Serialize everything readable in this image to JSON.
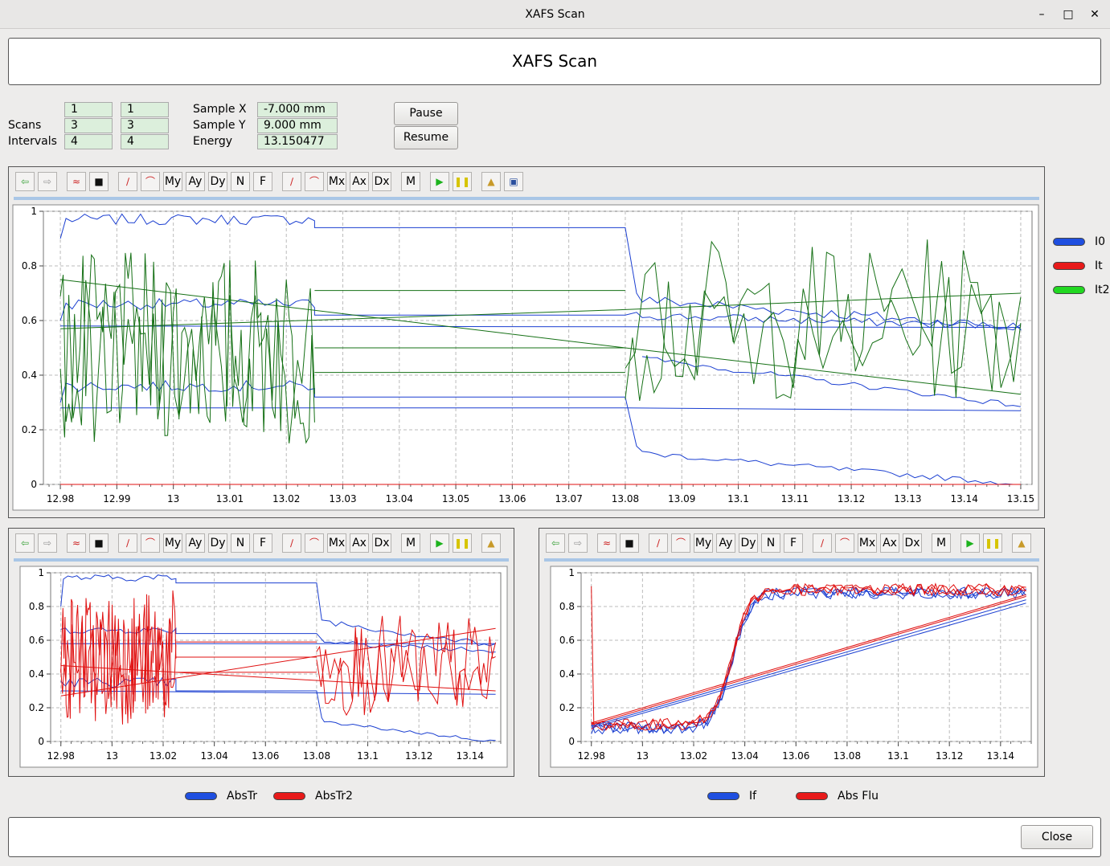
{
  "window": {
    "title": "XAFS Scan",
    "minimize_icon": "minimize-icon",
    "maximize_icon": "maximize-icon",
    "close_icon": "close-icon"
  },
  "header": {
    "title": "XAFS Scan"
  },
  "status": {
    "scans_label": "Scans",
    "intervals_label": "Intervals",
    "col1": [
      "1",
      "3",
      "4"
    ],
    "col2": [
      "1",
      "3",
      "4"
    ],
    "sample_x_label": "Sample X",
    "sample_y_label": "Sample Y",
    "energy_label": "Energy",
    "sample_x": "-7.000 mm",
    "sample_y": "9.000 mm",
    "energy": "13.150477"
  },
  "buttons": {
    "pause": "Pause",
    "resume": "Resume",
    "close": "Close"
  },
  "toolbar": {
    "labels": [
      "My",
      "Ay",
      "Dy",
      "N",
      "F",
      "Mx",
      "Ax",
      "Dx",
      "M"
    ]
  },
  "colors": {
    "blue": "#1b3fd1",
    "red": "#e01010",
    "green": "#157015",
    "legend_blue": "#1f4fe0",
    "legend_red": "#e81a1a",
    "legend_green": "#22d822"
  },
  "chart_data": [
    {
      "type": "line",
      "x_ticks": [
        "12.98",
        "12.99",
        "13",
        "13.01",
        "13.02",
        "13.03",
        "13.04",
        "13.05",
        "13.06",
        "13.07",
        "13.08",
        "13.09",
        "13.1",
        "13.11",
        "13.12",
        "13.13",
        "13.14",
        "13.15"
      ],
      "y_ticks": [
        "0",
        "0.2",
        "0.4",
        "0.6",
        "0.8",
        "1"
      ],
      "xlim": [
        12.977,
        13.152
      ],
      "ylim": [
        0,
        1
      ],
      "grid": true,
      "legend": "right",
      "series": [
        {
          "name": "I0",
          "color": "blue"
        },
        {
          "name": "It",
          "color": "red"
        },
        {
          "name": "It2",
          "color": "green"
        }
      ]
    },
    {
      "type": "line",
      "x_ticks": [
        "12.98",
        "13",
        "13.02",
        "13.04",
        "13.06",
        "13.08",
        "13.1",
        "13.12",
        "13.14"
      ],
      "y_ticks": [
        "0",
        "0.2",
        "0.4",
        "0.6",
        "0.8",
        "1"
      ],
      "xlim": [
        12.976,
        13.152
      ],
      "ylim": [
        0,
        1
      ],
      "grid": true,
      "legend": "bottom",
      "series": [
        {
          "name": "AbsTr",
          "color": "blue"
        },
        {
          "name": "AbsTr2",
          "color": "red"
        }
      ]
    },
    {
      "type": "line",
      "x_ticks": [
        "12.98",
        "13",
        "13.02",
        "13.04",
        "13.06",
        "13.08",
        "13.1",
        "13.12",
        "13.14"
      ],
      "y_ticks": [
        "0",
        "0.2",
        "0.4",
        "0.6",
        "0.8",
        "1"
      ],
      "xlim": [
        12.976,
        13.152
      ],
      "ylim": [
        0,
        1
      ],
      "grid": true,
      "legend": "bottom",
      "series": [
        {
          "name": "If",
          "color": "blue"
        },
        {
          "name": "Abs Flu",
          "color": "red"
        }
      ]
    }
  ]
}
